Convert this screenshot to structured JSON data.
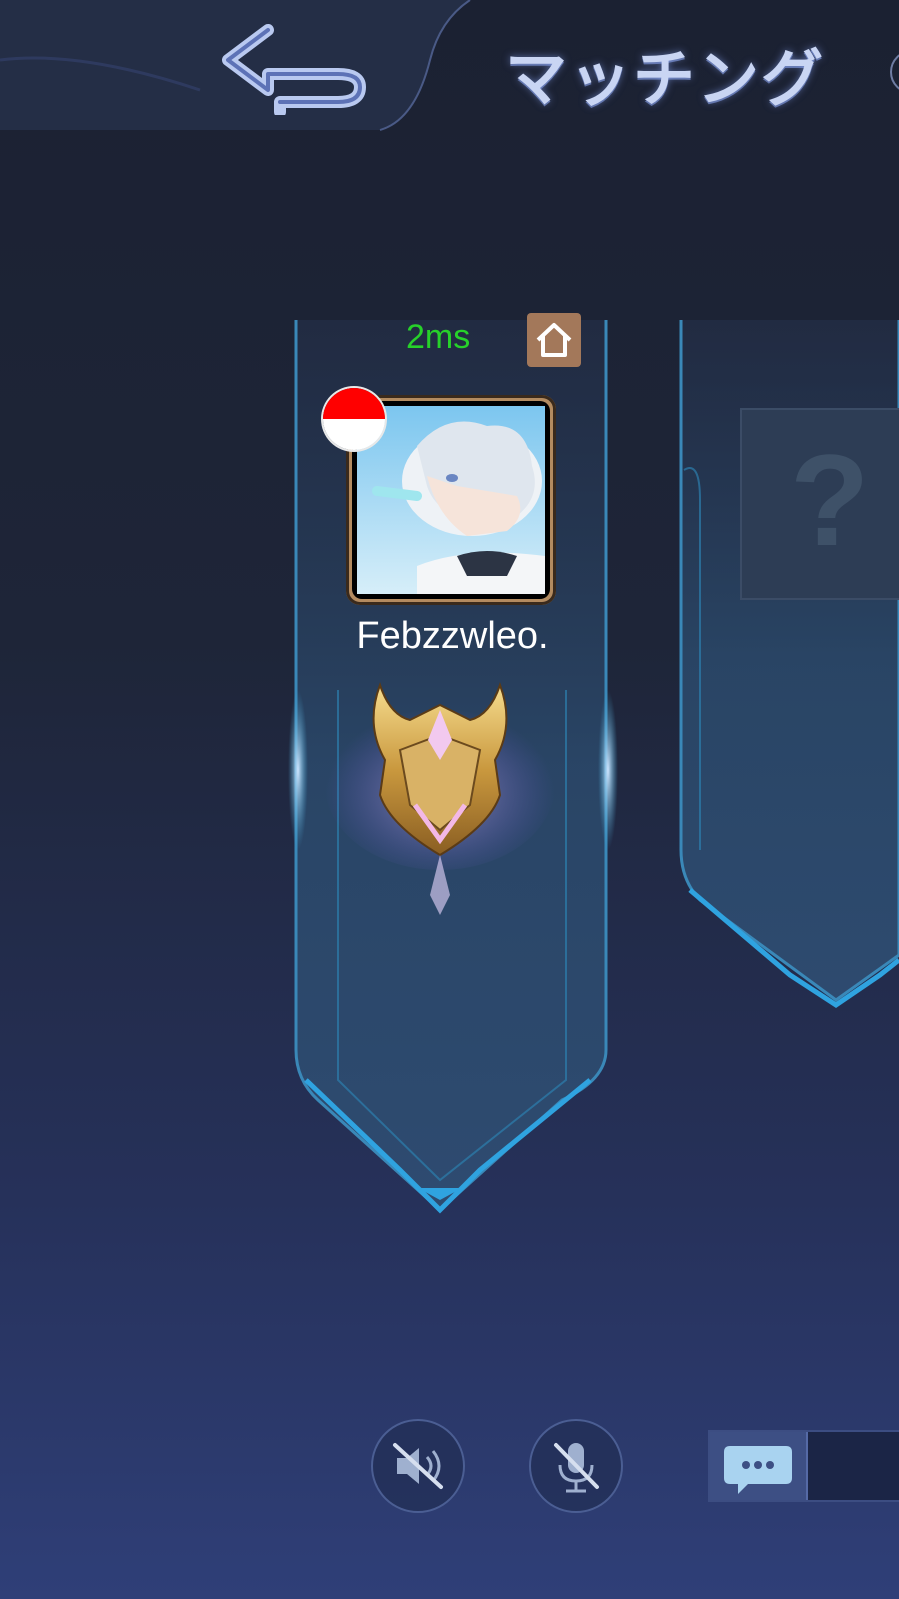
{
  "header": {
    "title": "マッチング",
    "back_icon": "back-arrow-icon"
  },
  "player_slot": {
    "ping": "2ms",
    "home_icon": "home-icon",
    "flag": "indonesia-flag-icon",
    "avatar": "avatar",
    "name": "Febzzwleo.",
    "rank_icon": "mythic-rank-emblem-icon"
  },
  "empty_slot": {
    "placeholder_icon": "question-mark-icon"
  },
  "controls": {
    "speaker_icon": "speaker-muted-icon",
    "mic_icon": "microphone-muted-icon",
    "chat_icon": "chat-bubble-icon"
  },
  "colors": {
    "ping": "#27d12a",
    "home_button": "#a3785a",
    "frame_glow": "#3fa8d8",
    "title": "#c9d5f3"
  }
}
